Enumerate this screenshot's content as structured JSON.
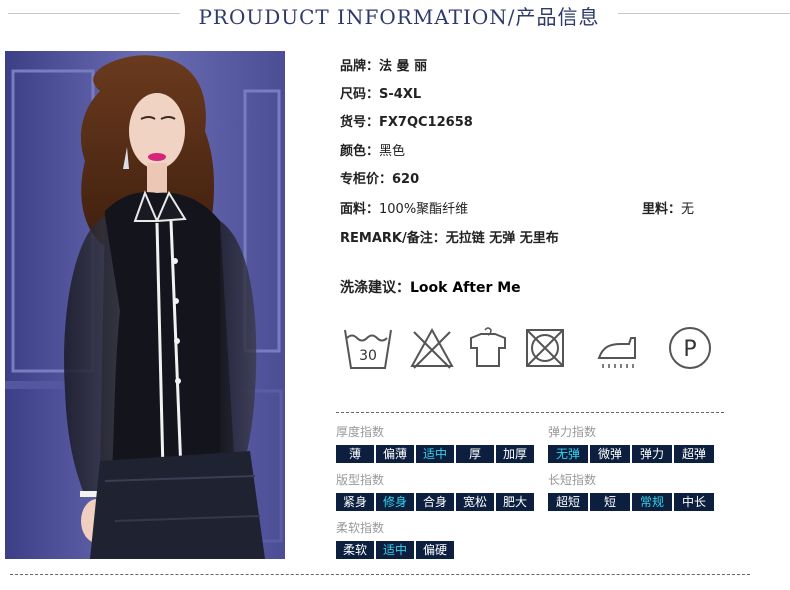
{
  "header": {
    "title": "PROUDUCT INFORMATION/产品信息"
  },
  "specs": {
    "brand": {
      "label": "品牌：",
      "value": "法 曼 丽"
    },
    "size": {
      "label": "尺码：",
      "value": "S-4XL"
    },
    "item_no": {
      "label": "货号：",
      "value": "FX7QC12658"
    },
    "color": {
      "label": "颜色：",
      "value": "黑色"
    },
    "price": {
      "label": "专柜价：",
      "value": "620"
    },
    "fabric": {
      "label": "面料：",
      "value": "100%聚酯纤维"
    },
    "lining": {
      "label": "里料：",
      "value": "无"
    },
    "remark": {
      "label": "REMARK/备注：",
      "value": "无拉链 无弹 无里布"
    },
    "wash": {
      "label": "洗涤建议：",
      "value": "Look After Me"
    }
  },
  "care_icons": [
    {
      "icon": "wash-30-icon",
      "text": "30"
    },
    {
      "icon": "no-bleach-icon"
    },
    {
      "icon": "hang-dry-icon"
    },
    {
      "icon": "no-tumble-dry-icon"
    },
    {
      "icon": "iron-steam-icon"
    },
    {
      "icon": "dry-clean-p-icon",
      "text": "P"
    }
  ],
  "indices": {
    "thickness": {
      "title": "厚度指数",
      "options": [
        "薄",
        "偏薄",
        "适中",
        "厚",
        "加厚"
      ],
      "selected": "适中"
    },
    "elasticity": {
      "title": "弹力指数",
      "options": [
        "无弹",
        "微弹",
        "弹力",
        "超弹"
      ],
      "selected": "无弹"
    },
    "fit": {
      "title": "版型指数",
      "options": [
        "紧身",
        "修身",
        "合身",
        "宽松",
        "肥大"
      ],
      "selected": "修身"
    },
    "length": {
      "title": "长短指数",
      "options": [
        "超短",
        "短",
        "常规",
        "中长"
      ],
      "selected": "常规"
    },
    "softness": {
      "title": "柔软指数",
      "options": [
        "柔软",
        "适中",
        "偏硬"
      ],
      "selected": "适中"
    }
  },
  "colors": {
    "title": "#2d3a6b",
    "tag_bg": "#0c1f3f",
    "tag_selected_text": "#35d3ee",
    "index_title": "#999999"
  }
}
